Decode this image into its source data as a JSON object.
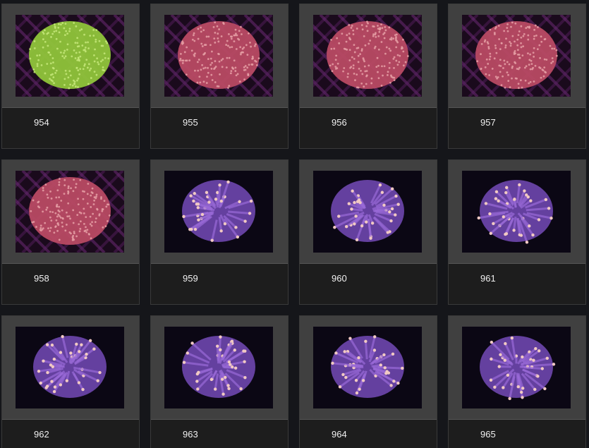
{
  "gallery": {
    "items": [
      {
        "label": "954",
        "style": "green"
      },
      {
        "label": "955",
        "style": "pink"
      },
      {
        "label": "956",
        "style": "pink"
      },
      {
        "label": "957",
        "style": "pink"
      },
      {
        "label": "958",
        "style": "pink"
      },
      {
        "label": "959",
        "style": "purple"
      },
      {
        "label": "960",
        "style": "purple"
      },
      {
        "label": "961",
        "style": "purple"
      },
      {
        "label": "962",
        "style": "purple"
      },
      {
        "label": "963",
        "style": "purple"
      },
      {
        "label": "964",
        "style": "purple"
      },
      {
        "label": "965",
        "style": "purple"
      }
    ]
  },
  "colors": {
    "page_bg": "#15161a",
    "frame_bg": "#404040",
    "card_bg": "#1d1d1d",
    "green_coral": "#8fc43a",
    "pink_coral": "#b84a63",
    "purple_coral": "#7b4fc2",
    "tip": "#f1c9c3"
  }
}
